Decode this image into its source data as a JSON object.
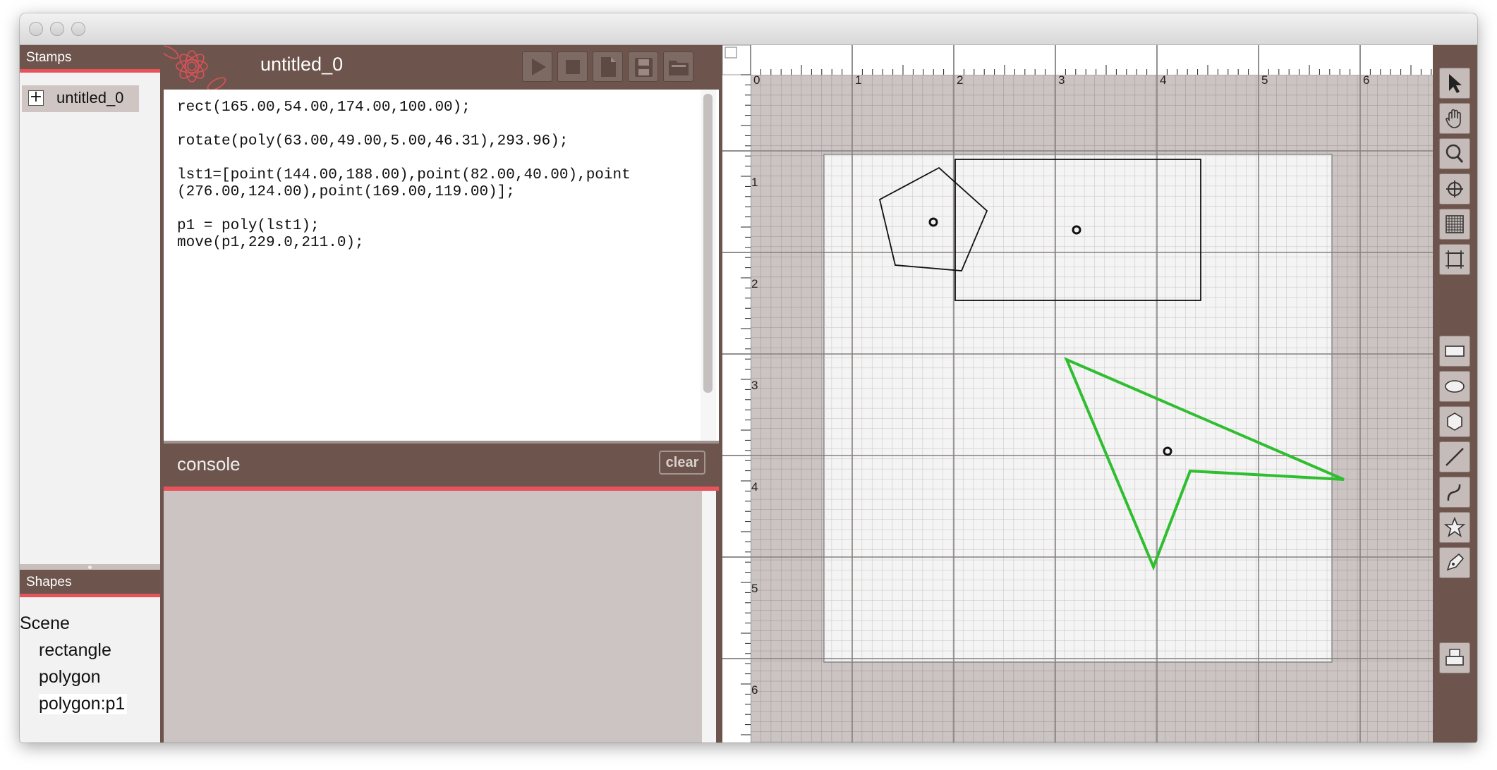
{
  "window": {
    "title": ""
  },
  "stamps": {
    "header": "Stamps",
    "items": [
      {
        "expander": "+",
        "label": "untitled_0"
      }
    ]
  },
  "shapes": {
    "header": "Shapes",
    "tree": {
      "root": "Scene",
      "children": [
        "rectangle",
        "polygon",
        "polygon:p1"
      ]
    }
  },
  "editor": {
    "title": "untitled_0",
    "toolbar": [
      "play-icon",
      "stop-icon",
      "new-file-icon",
      "save-icon",
      "open-folder-icon"
    ],
    "code": "rect(165.00,54.00,174.00,100.00);\n\nrotate(poly(63.00,49.00,5.00,46.31),293.96);\n\nlst1=[point(144.00,188.00),point(82.00,40.00),point\n(276.00,124.00),point(169.00,119.00)];\n\np1 = poly(lst1);\nmove(p1,229.0,211.0);"
  },
  "console": {
    "title": "console",
    "clear_label": "clear",
    "output": ""
  },
  "canvas": {
    "ruler_top_labels": [
      "0",
      "1",
      "2",
      "3",
      "4",
      "5",
      "6"
    ],
    "ruler_left_labels": [
      "1",
      "2",
      "3",
      "4",
      "5",
      "6"
    ],
    "colors": {
      "chrome": "#6d554d",
      "accent": "#e8525a",
      "selected_shape": "#2fbe2f",
      "grid_background": "#cbc4c3",
      "artboard": "#f2f2f2"
    }
  },
  "tools": [
    "pointer-icon",
    "hand-icon",
    "zoom-icon",
    "crosshair-icon",
    "grid-icon",
    "frame-icon",
    "rectangle-icon",
    "ellipse-icon",
    "hexagon-icon",
    "line-icon",
    "curve-icon",
    "star-icon",
    "pen-icon",
    "print-icon"
  ]
}
